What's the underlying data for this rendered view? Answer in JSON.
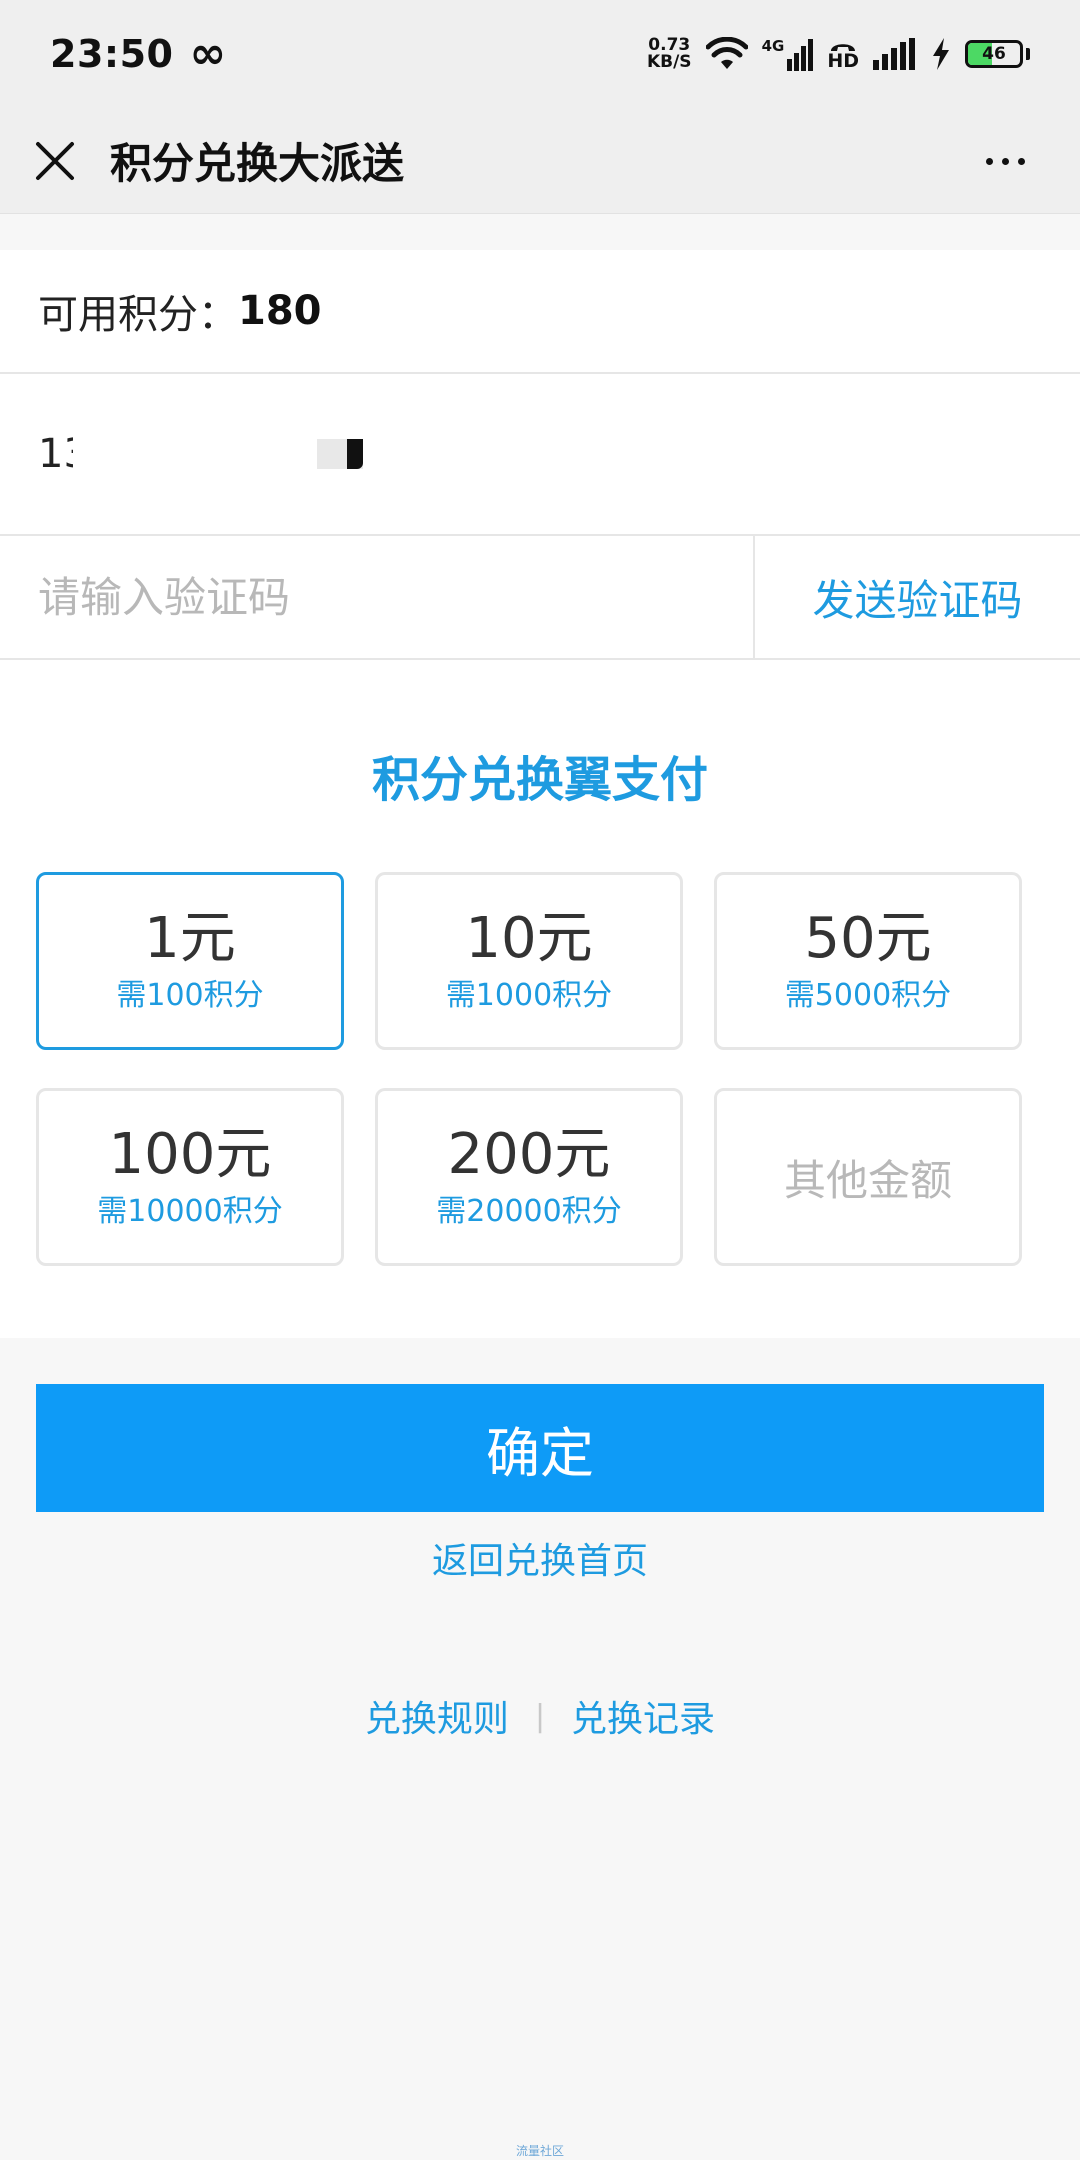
{
  "status_bar": {
    "time": "23:50",
    "infinity_glyph": "∞",
    "net_speed_value": "0.73",
    "net_speed_unit": "KB/S",
    "mobile_data_label": "4G",
    "hd_label": "HD",
    "battery_level": 46,
    "battery_label": "46",
    "icons": [
      "infinity-icon",
      "wifi-icon",
      "cellular-signal-icon",
      "hd-call-icon",
      "charging-icon",
      "battery-icon"
    ]
  },
  "nav": {
    "title": "积分兑换大派送",
    "close_icon": "close-icon",
    "more_icon": "more-icon"
  },
  "form": {
    "points_label": "可用积分：",
    "points_value": "180",
    "phone_prefix": "1",
    "phone_partial": "3",
    "code_placeholder": "请输入验证码",
    "send_code_label": "发送验证码"
  },
  "exchange": {
    "title": "积分兑换翼支付",
    "options": [
      {
        "amount": "1元",
        "cost": "需100积分",
        "selected": true
      },
      {
        "amount": "10元",
        "cost": "需1000积分",
        "selected": false
      },
      {
        "amount": "50元",
        "cost": "需5000积分",
        "selected": false
      },
      {
        "amount": "100元",
        "cost": "需10000积分",
        "selected": false
      },
      {
        "amount": "200元",
        "cost": "需20000积分",
        "selected": false
      }
    ],
    "other_label": "其他金额"
  },
  "actions": {
    "confirm_label": "确定",
    "back_label": "返回兑换首页"
  },
  "footer": {
    "rules_label": "兑换规则",
    "separator": "|",
    "records_label": "兑换记录",
    "watermark": "流量社区"
  },
  "colors": {
    "accent": "#1e9be0",
    "primary_button": "#0e9bf7",
    "placeholder": "#b8b8b8",
    "border": "#e6e6e6",
    "battery_fill": "#4cd964"
  }
}
